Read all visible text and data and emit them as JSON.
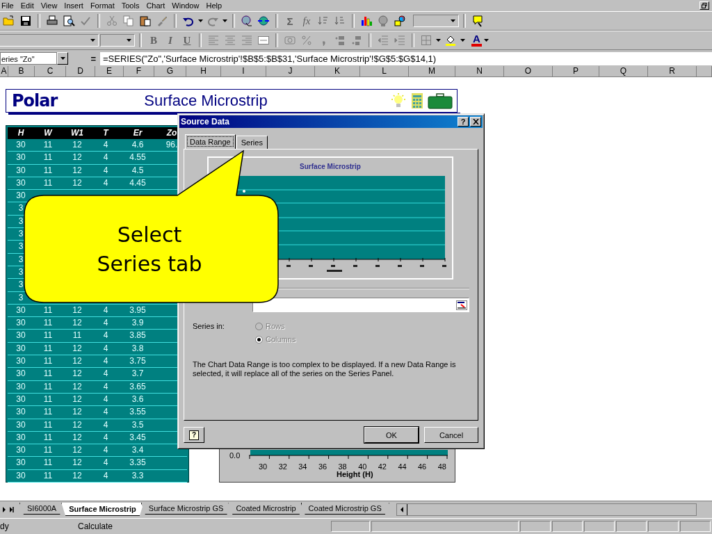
{
  "menu_bar": {
    "items": [
      "File",
      "Edit",
      "View",
      "Insert",
      "Format",
      "Tools",
      "Chart",
      "Window",
      "Help"
    ]
  },
  "standard_toolbar": {
    "sum_glyph": "Σ",
    "function_glyph": "fx"
  },
  "formatting_toolbar": {
    "style_buttons": [
      "B",
      "I",
      "U"
    ],
    "font_color_glyph": "A"
  },
  "formula_bar": {
    "name_box": "eries \"Zo\"",
    "equals": "=",
    "formula": "=SERIES(\"Zo\",'Surface Microstrip'!$B$5:$B$31,'Surface Microstrip'!$G$5:$G$14,1)"
  },
  "column_headers": [
    "A",
    "B",
    "C",
    "D",
    "E",
    "F",
    "G",
    "H",
    "I",
    "J",
    "K",
    "L",
    "M",
    "N",
    "O",
    "P",
    "Q",
    "R"
  ],
  "banner": {
    "logo": "Polar",
    "title": "Surface Microstrip"
  },
  "table": {
    "columns": [
      "H",
      "W",
      "W1",
      "T",
      "Er",
      "Zo"
    ],
    "rows": [
      [
        "30",
        "11",
        "12",
        "4",
        "4.6",
        "96."
      ],
      [
        "30",
        "11",
        "12",
        "4",
        "4.55"
      ],
      [
        "30",
        "11",
        "12",
        "4",
        "4.5"
      ],
      [
        "30",
        "11",
        "12",
        "4",
        "4.45"
      ],
      [
        "30"
      ],
      [
        "3"
      ],
      [
        "3"
      ],
      [
        "3"
      ],
      [
        "3"
      ],
      [
        "3"
      ],
      [
        "3"
      ],
      [
        "3"
      ],
      [
        "3"
      ],
      [
        "30",
        "11",
        "12",
        "4",
        "3.95"
      ],
      [
        "30",
        "11",
        "12",
        "4",
        "3.9"
      ],
      [
        "30",
        "11",
        "11",
        "4",
        "3.85"
      ],
      [
        "30",
        "11",
        "12",
        "4",
        "3.8"
      ],
      [
        "30",
        "11",
        "12",
        "4",
        "3.75"
      ],
      [
        "30",
        "11",
        "12",
        "4",
        "3.7"
      ],
      [
        "30",
        "11",
        "12",
        "4",
        "3.65"
      ],
      [
        "30",
        "11",
        "12",
        "4",
        "3.6"
      ],
      [
        "30",
        "11",
        "12",
        "4",
        "3.55"
      ],
      [
        "30",
        "11",
        "12",
        "4",
        "3.5"
      ],
      [
        "30",
        "11",
        "12",
        "4",
        "3.45"
      ],
      [
        "30",
        "11",
        "12",
        "4",
        "3.4"
      ],
      [
        "30",
        "11",
        "12",
        "4",
        "3.35"
      ],
      [
        "30",
        "11",
        "12",
        "4",
        "3.3"
      ]
    ]
  },
  "chart": {
    "y_tick": "0.0",
    "x_ticks": [
      "30",
      "32",
      "34",
      "36",
      "38",
      "40",
      "42",
      "44",
      "46",
      "48"
    ],
    "xlabel": "Height (H)"
  },
  "dialog": {
    "title": "Source Data",
    "title_help": "?",
    "tabs": [
      {
        "label": "Data Range",
        "selected": true
      },
      {
        "label": "Series",
        "selected": false
      }
    ],
    "preview_title": "Surface Microstrip",
    "series_in_label": "Series in:",
    "options": [
      {
        "label": "Rows",
        "selected": false,
        "disabled": true
      },
      {
        "label": "Columns",
        "selected": true,
        "disabled": true
      }
    ],
    "message": "The Chart Data Range is too complex to be displayed. If a new Data Range is selected, it will replace all of the series on the Series Panel.",
    "footer_help": "?",
    "buttons": [
      "OK",
      "Cancel"
    ]
  },
  "callout": {
    "lines": [
      "Select",
      "Series tab"
    ]
  },
  "sheet_tabs": [
    {
      "label": "SI6000A",
      "selected": false
    },
    {
      "label": "Surface Microstrip",
      "selected": true
    },
    {
      "label": "Surface Microstrip GS",
      "selected": false
    },
    {
      "label": "Coated Microstrip",
      "selected": false
    },
    {
      "label": "Coated Microstrip GS",
      "selected": false
    }
  ],
  "status_bar": {
    "mode": "dy",
    "message": "Calculate"
  }
}
